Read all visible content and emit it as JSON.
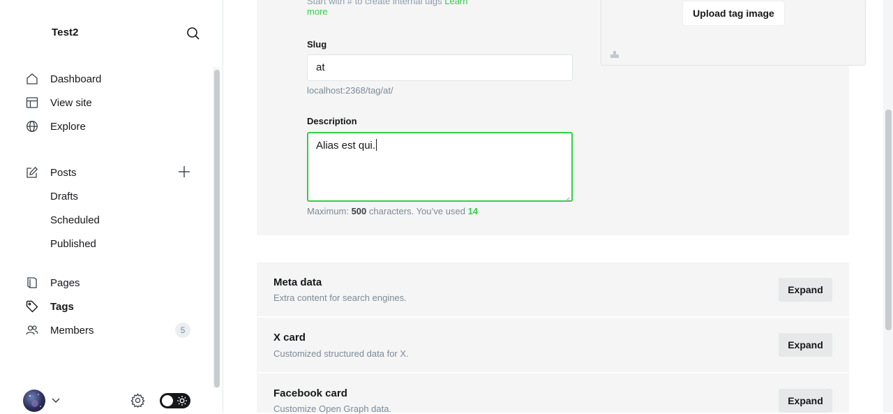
{
  "sidebar": {
    "site_title": "Test2",
    "nav": {
      "dashboard": "Dashboard",
      "view_site": "View site",
      "explore": "Explore",
      "posts": "Posts",
      "drafts": "Drafts",
      "scheduled": "Scheduled",
      "published": "Published",
      "pages": "Pages",
      "tags": "Tags",
      "members": "Members",
      "members_count": "5"
    }
  },
  "form": {
    "hint_top": "Start with # to create internal tags",
    "hint_learn": "Learn",
    "learn_more": "more",
    "slug_label": "Slug",
    "slug_value": "at",
    "slug_url": "localhost:2368/tag/at/",
    "description_label": "Description",
    "description_value": "Alias est qui.",
    "count_prefix": "Maximum:",
    "count_max": "500",
    "count_mid": "characters. You’ve used",
    "count_used": "14",
    "upload_label": "Upload tag image"
  },
  "sections": [
    {
      "title": "Meta data",
      "desc": "Extra content for search engines.",
      "button": "Expand"
    },
    {
      "title": "X card",
      "desc": "Customized structured data for X.",
      "button": "Expand"
    },
    {
      "title": "Facebook card",
      "desc": "Customize Open Graph data.",
      "button": "Expand"
    }
  ],
  "colors": {
    "accent": "#30cf43",
    "panel_bg": "#f4f5f4",
    "text": "#15171a",
    "muted": "#7c8b9a"
  }
}
